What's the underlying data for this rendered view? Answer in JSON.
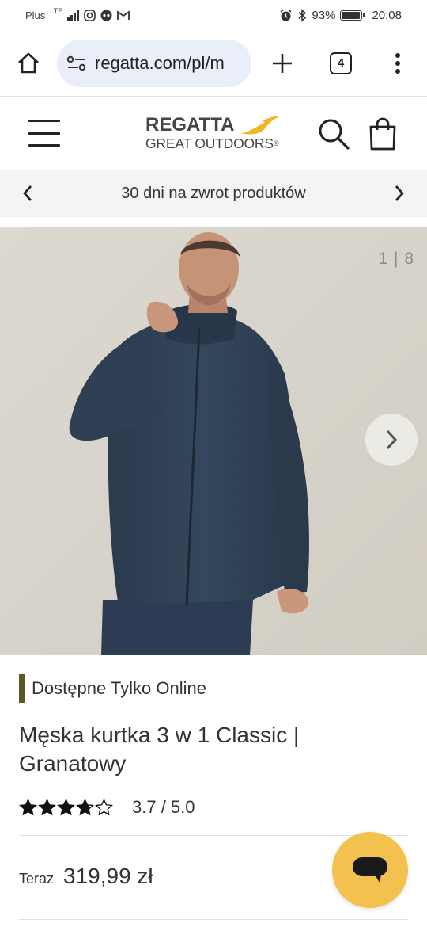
{
  "status_bar": {
    "carrier": "Plus",
    "network": "LTE",
    "battery": "93%",
    "battery_level": 0.93,
    "time": "20:08"
  },
  "browser": {
    "url": "regatta.com/pl/m",
    "tab_count": "4"
  },
  "site": {
    "logo_line1": "REGATTA",
    "logo_line2": "GREAT OUTDOORS",
    "logo_mark": "®",
    "accent_color": "#f2b52a"
  },
  "promo": {
    "text": "30 dni na zwrot produktów"
  },
  "gallery": {
    "counter": "1 | 8"
  },
  "product": {
    "availability_tag": "Dostępne Tylko Online",
    "title": "Męska kurtka 3 w 1 Classic | Granatowy",
    "rating": 3.7,
    "rating_text": "3.7 / 5.0",
    "price_label": "Teraz",
    "price": "319,99 zł"
  },
  "colors": {
    "chat_button": "#f2c14e",
    "online_tag_bar": "#5b5a24"
  }
}
